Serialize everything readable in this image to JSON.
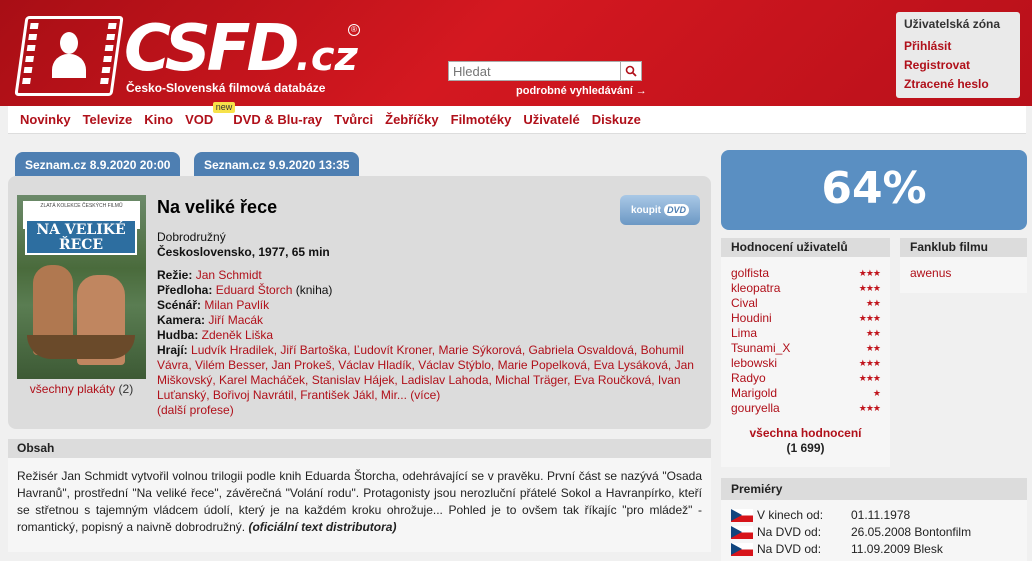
{
  "header": {
    "logo_main": "CSFD",
    "logo_tld": ".cz",
    "logo_reg": "®",
    "subtitle": "Česko-Slovenská filmová databáze",
    "search_placeholder": "Hledat",
    "advanced_search": "podrobné vyhledávání →",
    "user_zone": {
      "title": "Uživatelská zóna",
      "login": "Přihlásit",
      "register": "Registrovat",
      "lost_password": "Ztracené heslo"
    }
  },
  "nav": {
    "items": [
      "Novinky",
      "Televize",
      "Kino",
      "VOD",
      "DVD & Blu-ray",
      "Tvůrci",
      "Žebříčky",
      "Filmotéky",
      "Uživatelé",
      "Diskuze"
    ],
    "new_badge": "new"
  },
  "tabs": [
    "Seznam.cz 8.9.2020  20:00",
    "Seznam.cz 9.9.2020  13:35"
  ],
  "film": {
    "poster_top_text": "ZLATÁ KOLEKCE ČESKÝCH FILMŮ",
    "poster_title_line1": "NA VELIKÉ",
    "poster_title_line2": "ŘECE",
    "title": "Na veliké řece",
    "buy_label": "koupit",
    "buy_dvd": "DVD",
    "genre": "Dobrodružný",
    "origin": "Československo, 1977, 65 min",
    "all_posters": "všechny plakáty",
    "posters_count": "(2)",
    "credits": {
      "rezie_label": "Režie:",
      "rezie": "Jan Schmidt",
      "predloha_label": "Předloha:",
      "predloha": "Eduard Štorch",
      "predloha_note": "(kniha)",
      "scenar_label": "Scénář:",
      "scenar": "Milan Pavlík",
      "kamera_label": "Kamera:",
      "kamera": "Jiří Macák",
      "hudba_label": "Hudba:",
      "hudba": "Zdeněk Liška",
      "hraji_label": "Hrají:",
      "hraji": "Ludvík Hradilek, Jiří Bartoška, Ľudovít Kroner, Marie Sýkorová, Gabriela Osvaldová, Bohumil Vávra, Vilém Besser, Jan Prokeš, Václav Hladík, Václav Stýblo, Marie Popelková, Eva Lysáková, Jan Miškovský, Karel Macháček, Stanislav Hájek, Ladislav Lahoda, Michal Träger, Eva Roučková, Ivan Luťanský, Bořivoj Navrátil, František Jákl, Mir...",
      "more": "(více)",
      "other": "(další profese)"
    }
  },
  "obsah": {
    "heading": "Obsah",
    "text": "Režisér Jan Schmidt vytvořil volnou trilogii podle knih Eduarda Štorcha, odehrávající se v pravěku. První část se nazývá \"Osada Havranů\", prostřední \"Na veliké řece\", závěrečná \"Volání rodu\". Protagonisty jsou nerozluční přátelé Sokol a Havranpírko, kteří se střetnou s tajemným vládcem údolí, který je na každém kroku ohrožuje... Pohled je to ovšem tak říkajíc \"pro mládež\" - romantický, popisný a naivně dobrodružný.",
    "source": "(oficiální text distributora)"
  },
  "rating": {
    "value": "64%",
    "color": "#5a8fc2"
  },
  "user_ratings": {
    "heading": "Hodnocení uživatelů",
    "items": [
      {
        "user": "golfista",
        "stars": "★★★"
      },
      {
        "user": "kleopatra",
        "stars": "★★★"
      },
      {
        "user": "Cival",
        "stars": "★★"
      },
      {
        "user": "Houdini",
        "stars": "★★★"
      },
      {
        "user": "Lima",
        "stars": "★★"
      },
      {
        "user": "Tsunami_X",
        "stars": "★★"
      },
      {
        "user": "lebowski",
        "stars": "★★★"
      },
      {
        "user": "Radyo",
        "stars": "★★★"
      },
      {
        "user": "Marigold",
        "stars": "★"
      },
      {
        "user": "gouryella",
        "stars": "★★★"
      }
    ],
    "all_label": "všechna hodnocení",
    "count": "(1 699)"
  },
  "fanclub": {
    "heading": "Fanklub filmu",
    "members": [
      "awenus"
    ]
  },
  "premieres": {
    "heading": "Premiéry",
    "items": [
      {
        "label": "V kinech od:",
        "value": "01.11.1978"
      },
      {
        "label": "Na DVD od:",
        "value": "26.05.2008 Bontonfilm"
      },
      {
        "label": "Na DVD od:",
        "value": "11.09.2009 Blesk"
      }
    ]
  }
}
